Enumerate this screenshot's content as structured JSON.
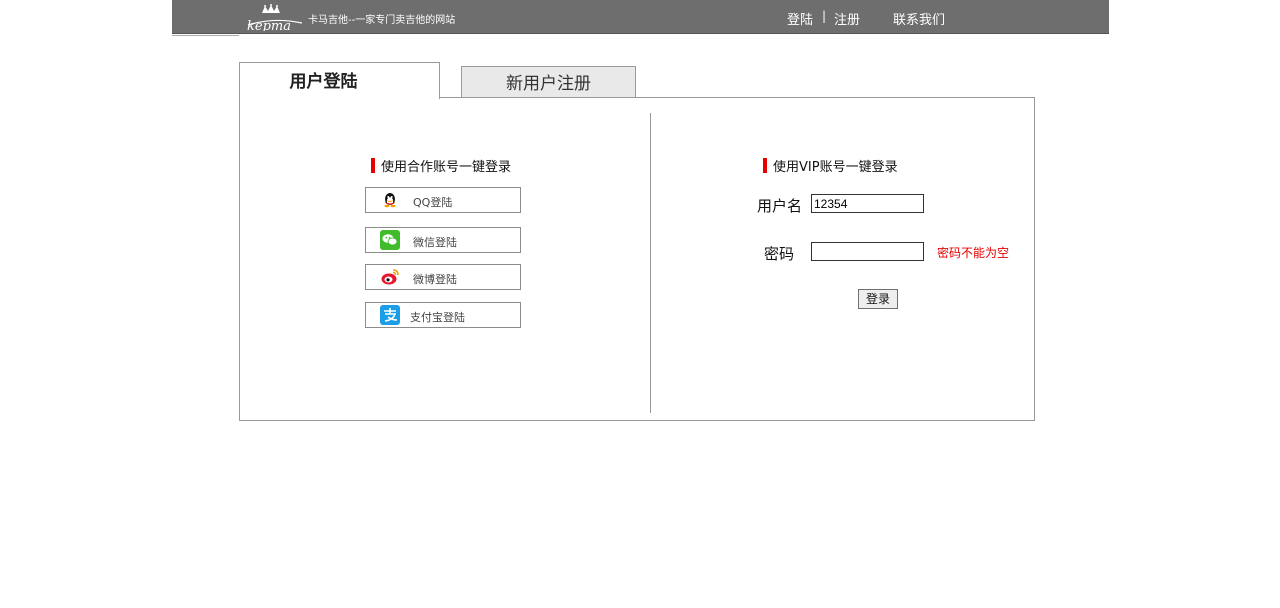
{
  "header": {
    "logo_text": "kepma",
    "slogan": "卡马吉他--一家专门卖吉他的网站",
    "nav": {
      "login": "登陆",
      "separator": "|",
      "register": "注册",
      "contact": "联系我们"
    }
  },
  "tabs": [
    {
      "label": "用户登陆",
      "active": true
    },
    {
      "label": "新用户注册",
      "active": false
    }
  ],
  "partner_login": {
    "title": "使用合作账号一键登录",
    "buttons": [
      {
        "label": "QQ登陆",
        "icon": "qq-penguin-icon"
      },
      {
        "label": "微信登陆",
        "icon": "wechat-icon"
      },
      {
        "label": "微博登陆",
        "icon": "weibo-icon"
      },
      {
        "label": "支付宝登陆",
        "icon": "alipay-icon"
      }
    ]
  },
  "vip_login": {
    "title": "使用VIP账号一键登录",
    "username_label": "用户名",
    "username_value": "12354",
    "password_label": "密码",
    "password_value": "",
    "password_error": "密码不能为空",
    "submit_label": "登录"
  },
  "colors": {
    "topbar": "#6e6e6e",
    "accent_red": "#e60000",
    "border": "#9a9a9a"
  }
}
